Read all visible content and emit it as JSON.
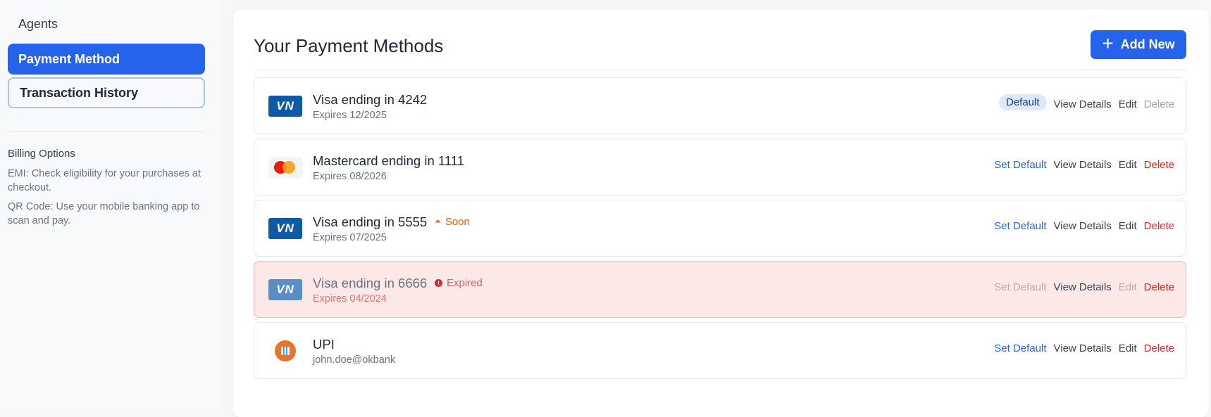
{
  "sidebar": {
    "link": "Agents",
    "items": [
      {
        "label": "Payment Method"
      },
      {
        "label": "Transaction History"
      }
    ],
    "billing": {
      "title": "Billing Options",
      "lines": [
        "EMI: Check eligibility for your purchases at checkout.",
        "QR Code: Use your mobile banking app to scan and pay."
      ]
    }
  },
  "main": {
    "title": "Your Payment Methods",
    "add_label": "Add New",
    "add_icon": "+",
    "methods": [
      {
        "logo": "VN",
        "title": "Visa ending in 4242",
        "sub": "Expires 12/2025",
        "badge": "Default",
        "view": "View Details",
        "edit": "Edit",
        "delete": "Delete"
      },
      {
        "logo": "",
        "title": "Mastercard ending in 1111",
        "sub": "Expires 08/2026",
        "set_default": "Set Default",
        "view": "View Details",
        "edit": "Edit",
        "delete": "Delete"
      },
      {
        "logo": "VN",
        "title": "Visa ending in 5555",
        "sub": "Expires 07/2025",
        "tag": "Soon",
        "set_default": "Set Default",
        "view": "View Details",
        "edit": "Edit",
        "delete": "Delete"
      },
      {
        "logo": "VN",
        "title": "Visa ending in 6666",
        "sub": "Expires 04/2024",
        "tag": "Expired",
        "set_default": "Set Default",
        "view": "View Details",
        "edit": "Edit",
        "delete": "Delete"
      },
      {
        "logo": "",
        "title": "UPI",
        "sub": "john.doe@okbank",
        "set_default": "Set Default",
        "view": "View Details",
        "edit": "Edit",
        "delete": "Delete"
      }
    ]
  }
}
